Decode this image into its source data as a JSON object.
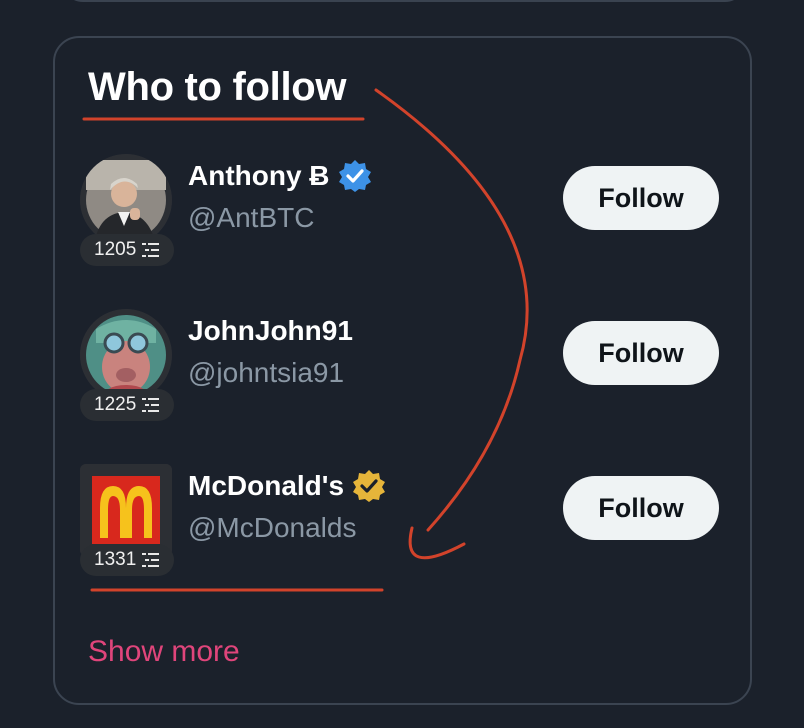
{
  "panel": {
    "title": "Who to follow",
    "show_more_label": "Show more"
  },
  "accounts": [
    {
      "name": "Anthony Ƀ",
      "handle": "@AntBTC",
      "count": "1205",
      "verified": "blue",
      "follow_label": "Follow"
    },
    {
      "name": "JohnJohn91",
      "handle": "@johntsia91",
      "count": "1225",
      "verified": "none",
      "follow_label": "Follow"
    },
    {
      "name": "McDonald's",
      "handle": "@McDonalds",
      "count": "1331",
      "verified": "gold",
      "follow_label": "Follow"
    }
  ],
  "colors": {
    "background": "#1b212b",
    "card_border": "#3b4451",
    "handle": "#8b98a5",
    "show_more": "#e0457b",
    "annotation": "#d2432b",
    "verified_blue": "#3d92e7",
    "verified_gold": "#e6b53a",
    "follow_button": "#eff3f4"
  },
  "icons": {
    "verified_blue": "verified-badge-icon",
    "verified_gold": "verified-org-badge-icon",
    "count": "list-icon"
  }
}
